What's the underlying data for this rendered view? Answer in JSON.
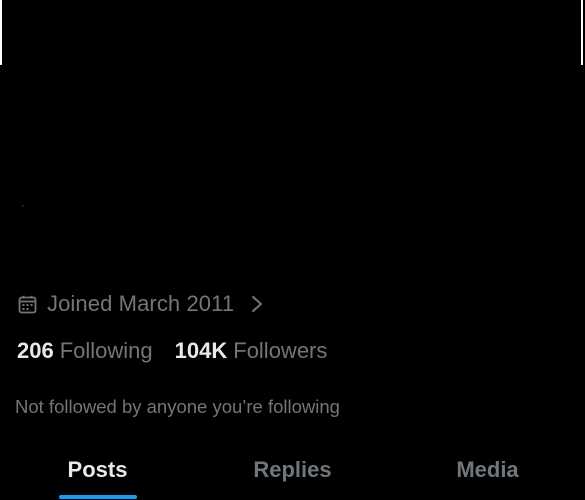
{
  "profile": {
    "joined_text": "Joined March 2011",
    "following_count": "206",
    "following_label": "Following",
    "followers_count": "104K",
    "followers_label": "Followers",
    "not_followed_text": "Not followed by anyone you’re following"
  },
  "tabs": [
    {
      "label": "Posts",
      "active": true
    },
    {
      "label": "Replies",
      "active": false
    },
    {
      "label": "Media",
      "active": false
    }
  ],
  "icons": {
    "calendar": "calendar-icon",
    "chevron": "chevron-right-icon"
  },
  "colors": {
    "background": "#000000",
    "primary_text": "#e7e9ea",
    "secondary_text": "#71767b",
    "accent": "#1d9bf0"
  }
}
